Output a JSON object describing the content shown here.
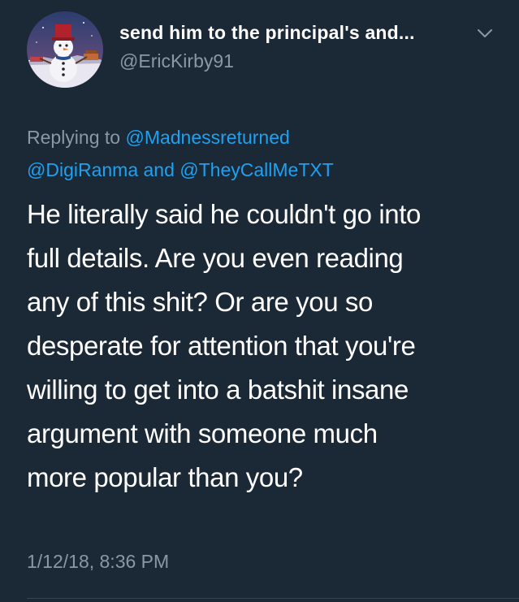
{
  "tweet": {
    "author": {
      "display_name": "send him to the principal's and...",
      "handle": "@EricKirby91",
      "avatar_icon": "snowman-avatar-icon"
    },
    "menu_icon": "chevron-down-icon",
    "reply_context": {
      "prefix": "Replying to",
      "mention_1": "@Madnessreturned",
      "mention_2": "@DigiRanma",
      "conjunction": "and",
      "mention_3": "@TheyCallMeTXT"
    },
    "body_lines": [
      "He literally said he couldn't go into",
      "full details. Are you even reading",
      "any of this shit? Or are you so",
      "desperate for attention that you're",
      "willing to get into a batshit insane",
      "argument with someone much",
      "more popular than you?"
    ],
    "timestamp": "1/12/18, 8:36 PM"
  },
  "colors": {
    "background": "#1b2836",
    "text": "#ffffff",
    "secondary_text": "#8899a6",
    "link": "#1da1f2",
    "divider": "#38444d"
  }
}
